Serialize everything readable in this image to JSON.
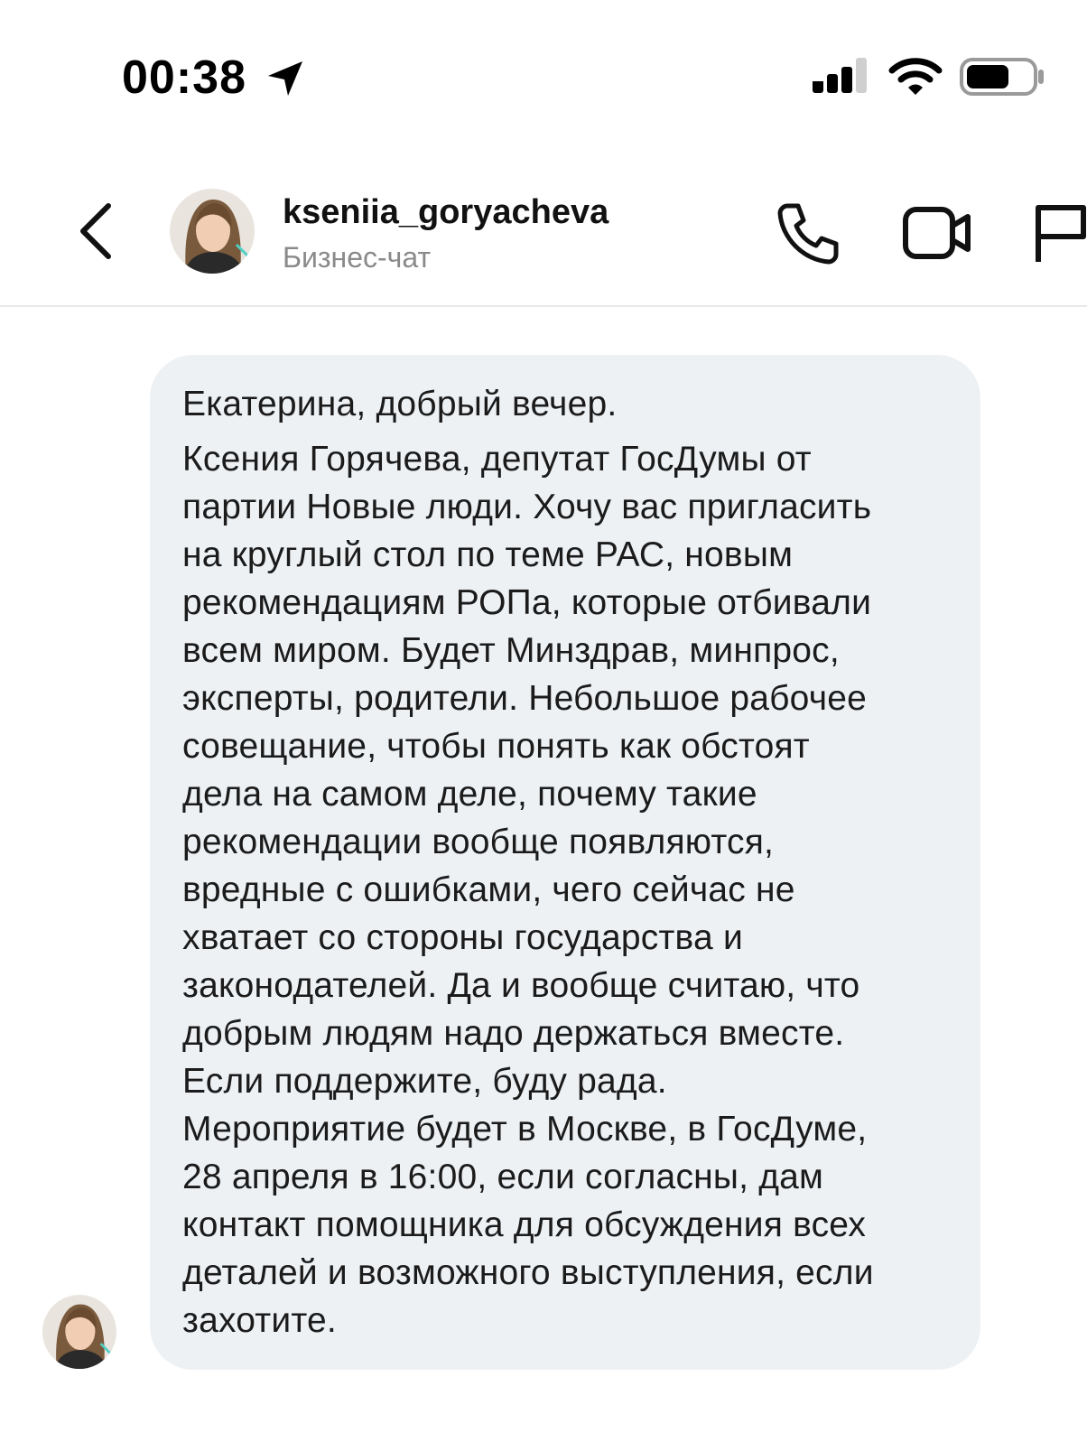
{
  "status_bar": {
    "time": "00:38",
    "icons": [
      "location-arrow-icon",
      "cellular-signal-icon",
      "wifi-icon",
      "battery-icon"
    ]
  },
  "header": {
    "contact_name": "kseniia_goryacheva",
    "subtitle": "Бизнес-чат",
    "actions": [
      "back-chevron-icon",
      "phone-icon",
      "video-camera-icon",
      "flag-icon"
    ]
  },
  "message": {
    "lines": [
      "Екатерина, добрый вечер.",
      "Ксения Горячева, депутат ГосДумы от",
      "партии Новые люди. Хочу вас пригласить",
      "на круглый стол по теме РАС, новым",
      "рекомендациям РОПа, которые отбивали",
      "всем миром. Будет Минздрав, минпрос,",
      "эксперты, родители. Небольшое рабочее",
      "совещание, чтобы понять как обстоят",
      "дела на самом деле, почему такие",
      "рекомендации вообще появляются,",
      "вредные с ошибками, чего сейчас не",
      "хватает со стороны государства и",
      "законодателей. Да и вообще считаю, что",
      "добрым людям надо держаться вместе.",
      "Если поддержите, буду рада.",
      "Мероприятие будет в Москве, в ГосДуме,",
      "28 апреля в 16:00, если согласны, дам",
      "контакт помощника для обсуждения всех",
      "деталей и возможного выступления, если",
      "захотите."
    ]
  },
  "colors": {
    "bubble": "#eef1f4",
    "text": "#1b1b1b",
    "subtitle": "#8a8a8a",
    "divider": "#e8e8e8"
  }
}
